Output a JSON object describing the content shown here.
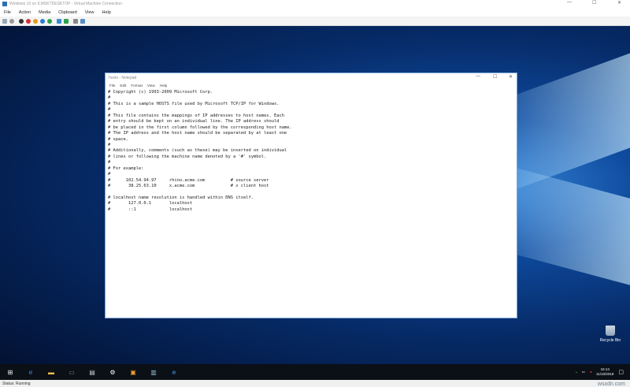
{
  "window": {
    "title": "Windows 10 on ILMSKTDESKTOP - Virtual Machine Connection",
    "minimize": "—",
    "maximize": "☐",
    "close": "✕"
  },
  "menu": [
    "File",
    "Action",
    "Media",
    "Clipboard",
    "View",
    "Help"
  ],
  "toolbar_icons": [
    {
      "name": "ctrl-alt-del-icon",
      "color": "#9aa7b4"
    },
    {
      "name": "start-icon",
      "color": "#9a9a9a"
    },
    {
      "name": "turn-off-icon",
      "color": "#333333"
    },
    {
      "name": "shutdown-icon",
      "color": "#d83030"
    },
    {
      "name": "save-icon",
      "color": "#e59a1d"
    },
    {
      "name": "pause-icon",
      "color": "#2a7bd4"
    },
    {
      "name": "reset-icon",
      "color": "#2aa24a"
    },
    {
      "name": "checkpoint-icon",
      "color": "#3c8ad6"
    },
    {
      "name": "revert-icon",
      "color": "#2aa24a"
    },
    {
      "name": "enhanced-session-icon",
      "color": "#888888"
    },
    {
      "name": "share-icon",
      "color": "#5a8fc8"
    }
  ],
  "notepad": {
    "title": "hosts - Notepad",
    "menu": [
      "File",
      "Edit",
      "Format",
      "View",
      "Help"
    ],
    "lines": [
      "# Copyright (c) 1993-2009 Microsoft Corp.",
      "#",
      "# This is a sample HOSTS file used by Microsoft TCP/IP for Windows.",
      "#",
      "# This file contains the mappings of IP addresses to host names. Each",
      "# entry should be kept on an individual line. The IP address should",
      "# be placed in the first column followed by the corresponding host name.",
      "# The IP address and the host name should be separated by at least one",
      "# space.",
      "#",
      "# Additionally, comments (such as these) may be inserted on individual",
      "# lines or following the machine name denoted by a '#' symbol.",
      "#",
      "# For example:",
      "#",
      "#      102.54.94.97     rhino.acme.com          # source server",
      "#       38.25.63.10     x.acme.com              # x client host",
      "",
      "# localhost name resolution is handled within DNS itself.",
      "#       127.0.0.1       localhost",
      "#       ::1             localhost"
    ]
  },
  "desktop": {
    "recycle_bin": "Recycle Bin"
  },
  "taskbar": {
    "time": "15:14",
    "date": "11/10/2018"
  },
  "status": "Status: Running",
  "watermark": "wsxdn.com"
}
